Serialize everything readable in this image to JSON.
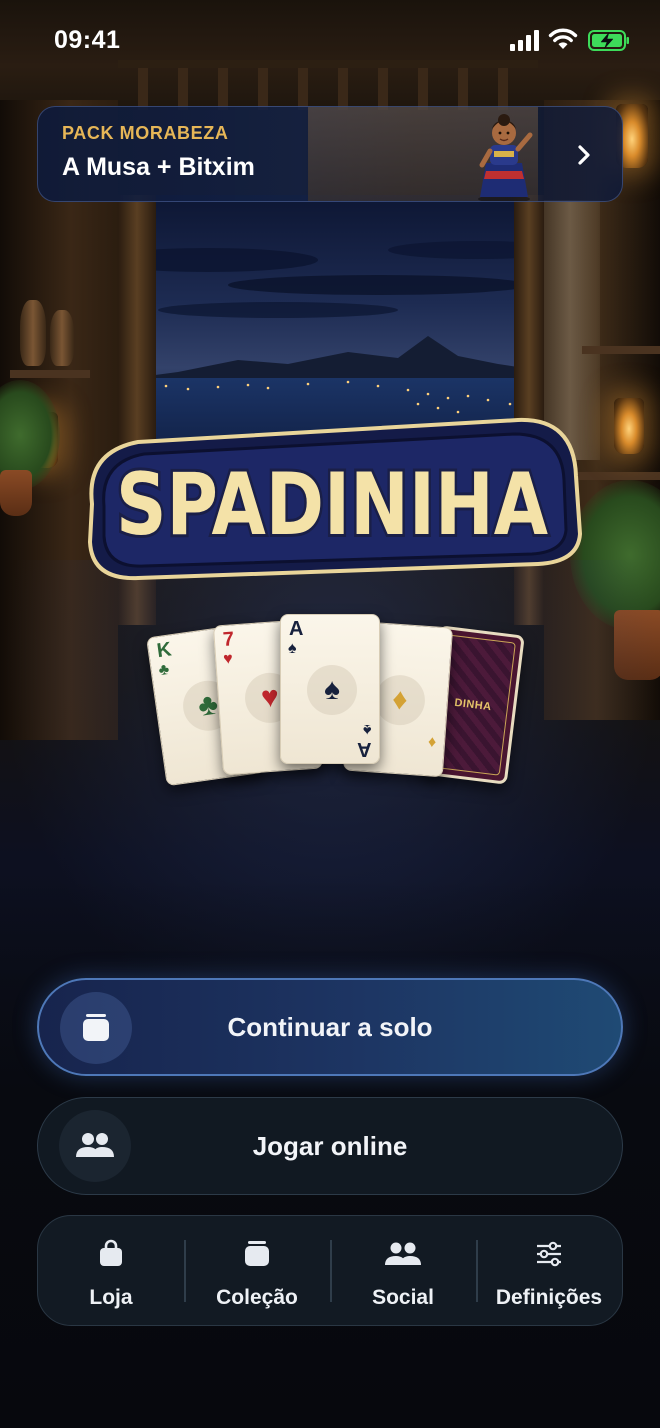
{
  "status_bar": {
    "time": "09:41"
  },
  "promo": {
    "kicker": "PACK MORABEZA",
    "title": "A Musa + Bitxim",
    "chevron_icon": "chevron-right-icon"
  },
  "logo": {
    "text": "SPADINIHA"
  },
  "cards": [
    {
      "rank": "K",
      "suit": "♣",
      "color": "#2f6b3a"
    },
    {
      "rank": "7",
      "suit": "♥",
      "color": "#c0272d"
    },
    {
      "rank": "A",
      "suit": "♠",
      "color": "#17213d"
    },
    {
      "rank": "",
      "suit": "♦",
      "color": "#d4a235"
    }
  ],
  "card_back": {
    "label": "DINHA"
  },
  "buttons": {
    "solo": {
      "label": "Continuar a solo",
      "icon": "card-stack-icon"
    },
    "online": {
      "label": "Jogar online",
      "icon": "people-icon"
    }
  },
  "nav": [
    {
      "label": "Loja",
      "icon": "shopping-bag-icon"
    },
    {
      "label": "Coleção",
      "icon": "card-stack-icon"
    },
    {
      "label": "Social",
      "icon": "people-icon"
    },
    {
      "label": "Definições",
      "icon": "sliders-icon"
    }
  ],
  "colors": {
    "accent_gold": "#e6b657",
    "primary_button": "#1d3563",
    "primary_border": "#4e78b8",
    "surface": "#121a23",
    "battery_green": "#3ddc5a"
  }
}
